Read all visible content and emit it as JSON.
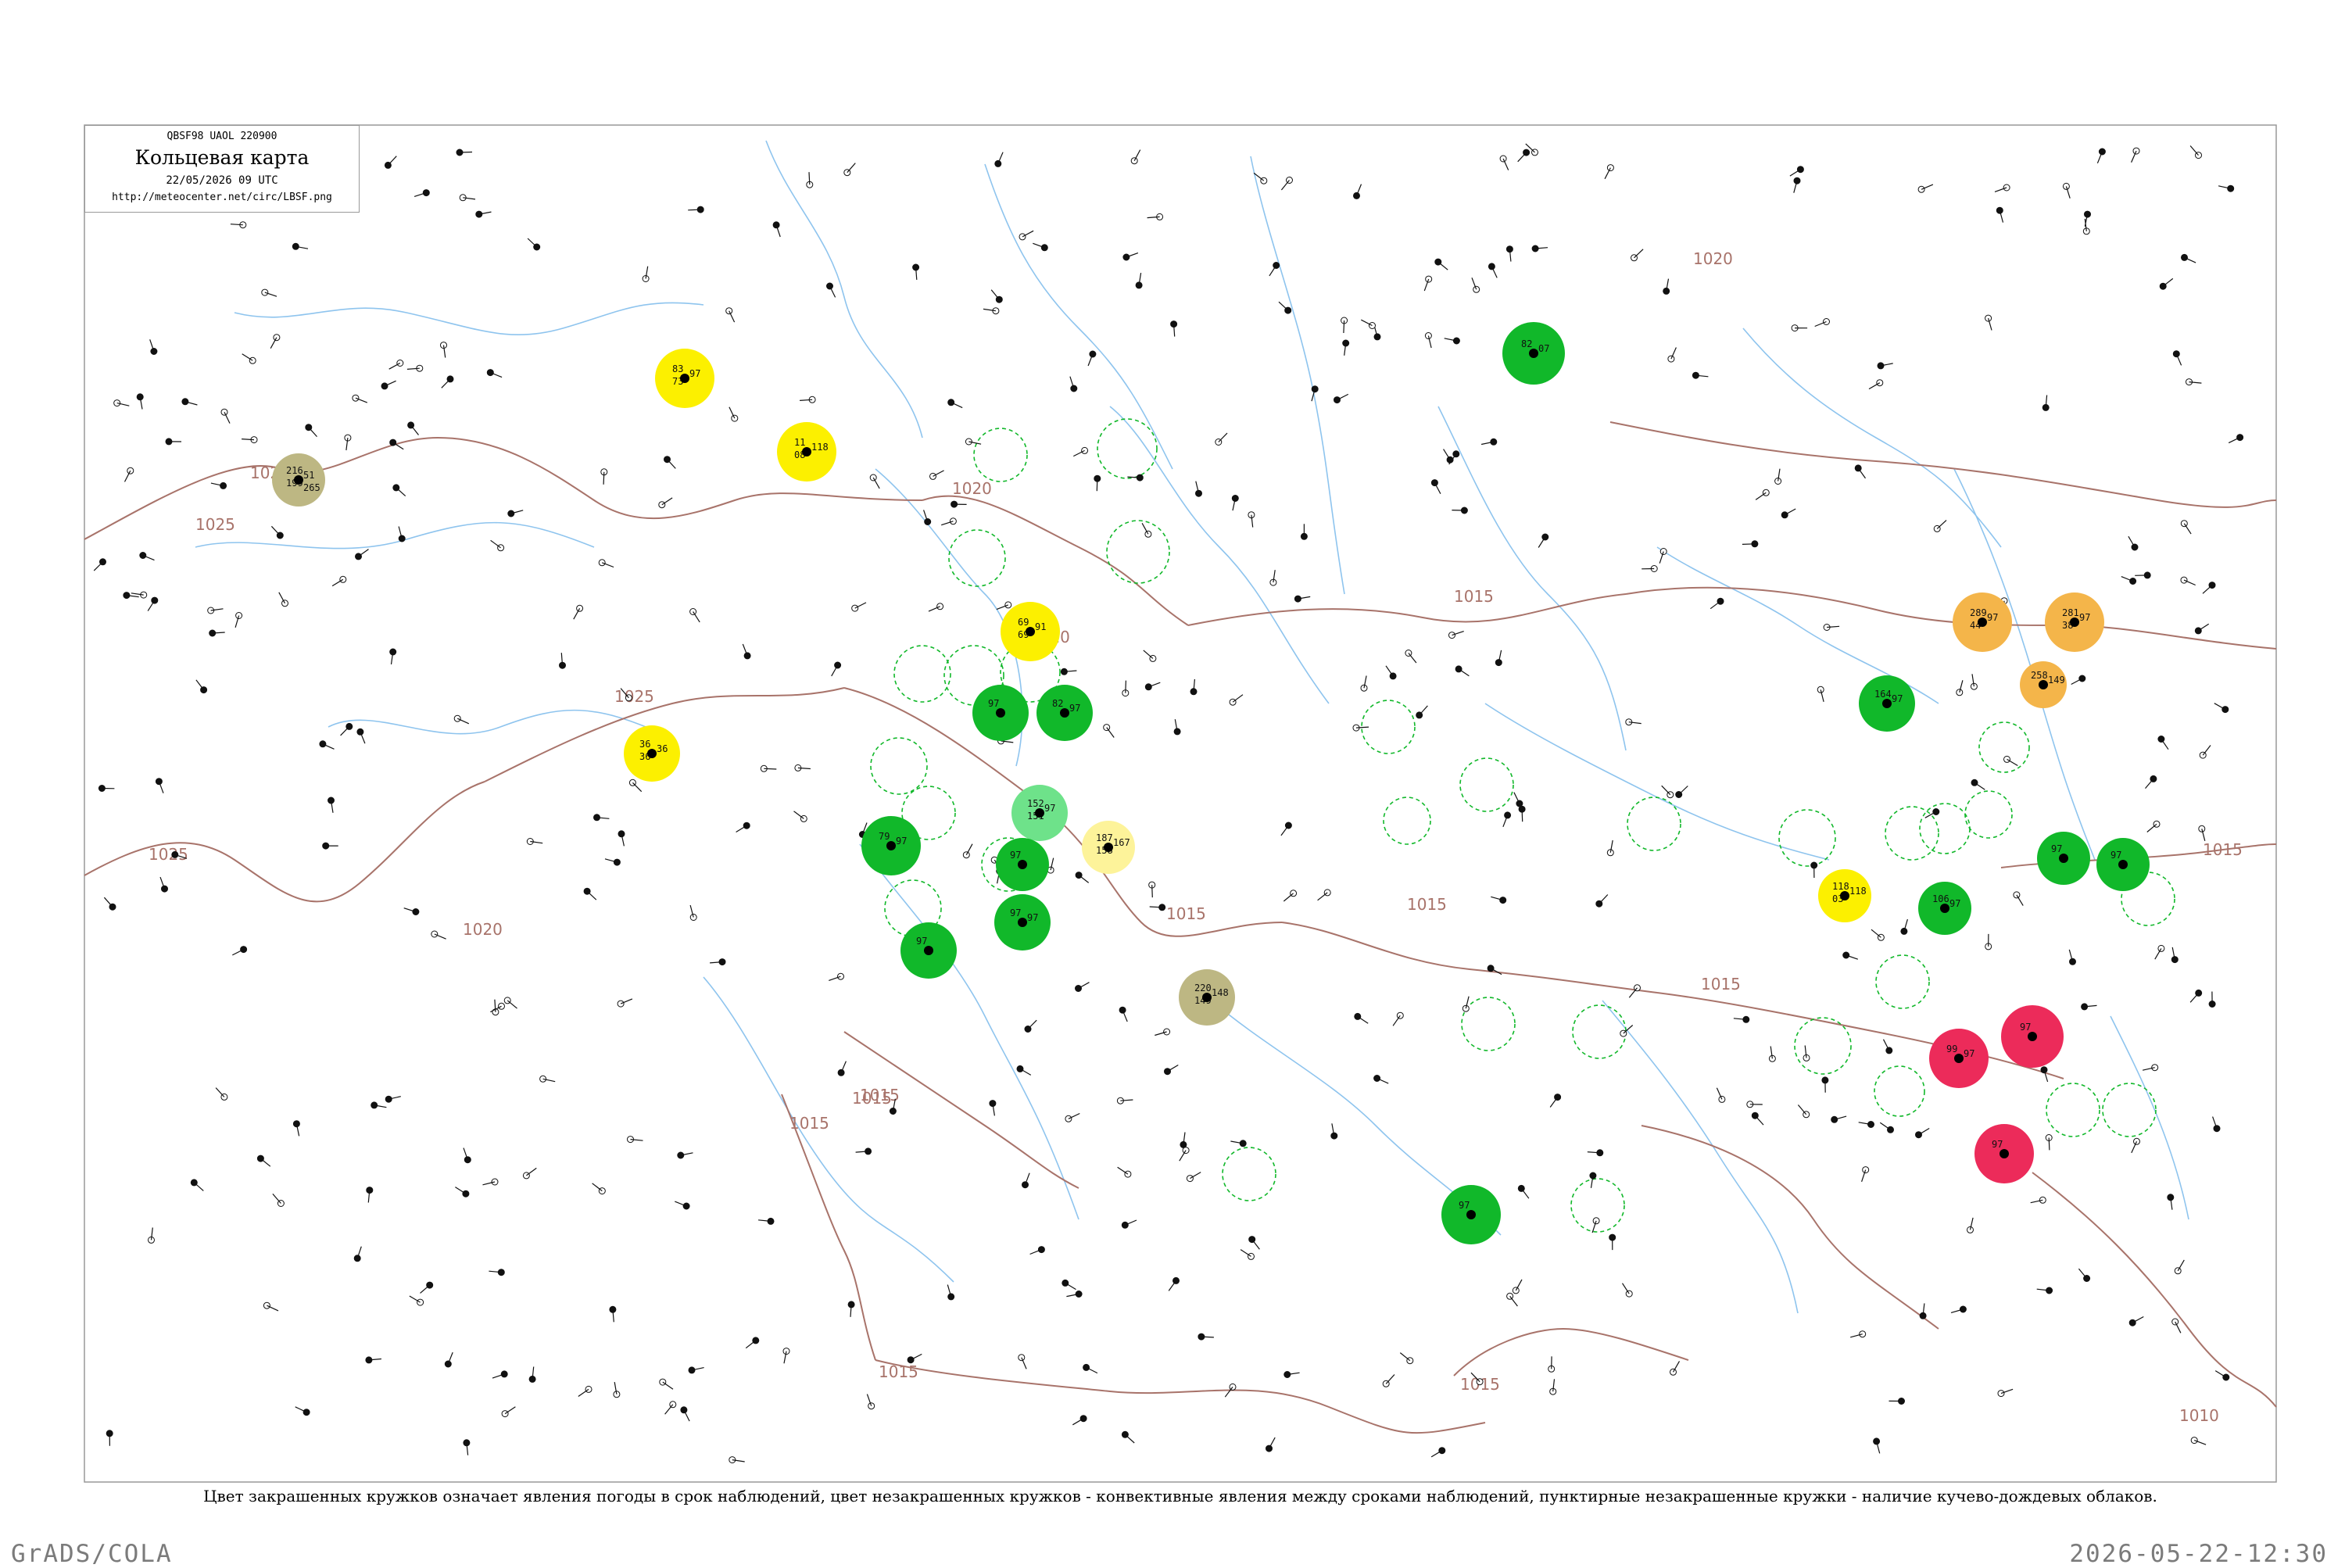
{
  "header": {
    "code": "QBSF98  UAOL  220900",
    "title": "Кольцевая карта",
    "date": "22/05/2026 09 UTC",
    "url": "http://meteocenter.net/circ/LBSF.png"
  },
  "caption": "Цвет закрашенных кружков означает явления погоды в срок наблюдений, цвет незакрашенных кружков - конвективные явления между сроками наблюдений, пунктирные незакрашенные кружки - наличие кучево-дождевых облаков.",
  "footer": {
    "left": "GrADS/COLA",
    "right": "2026-05-22-12:30"
  },
  "colors": {
    "green": "#11b82a",
    "yellow": "#fcf000",
    "orange": "#f4b54a",
    "red": "#ec2b5a",
    "khaki": "#bdb783",
    "light_yellow": "#fdf39a",
    "light_green": "#6ee28a",
    "isobar": "#a8736a",
    "river": "#8ec4ee"
  },
  "isobar_labels": [
    "1025",
    "1025",
    "1025",
    "1025",
    "1020",
    "1020",
    "1020",
    "1020",
    "1015",
    "1015",
    "1015",
    "1015",
    "1015",
    "1015",
    "1015",
    "1015",
    "1015",
    "1015",
    "1010"
  ],
  "highlight_stations": [
    {
      "kind": "filled",
      "color": "green",
      "values": [
        "82",
        "07"
      ]
    },
    {
      "kind": "filled",
      "color": "yellow",
      "values": [
        "83",
        "97",
        "73"
      ]
    },
    {
      "kind": "filled",
      "color": "yellow",
      "values": [
        "11",
        "118",
        "08"
      ]
    },
    {
      "kind": "filled",
      "color": "khaki",
      "values": [
        "216",
        "51",
        "199",
        "265"
      ]
    },
    {
      "kind": "filled",
      "color": "yellow",
      "values": [
        "69",
        "91",
        "69"
      ]
    },
    {
      "kind": "filled",
      "color": "yellow",
      "values": [
        "36",
        "36",
        "36"
      ]
    },
    {
      "kind": "filled",
      "color": "green",
      "values": [
        "97"
      ]
    },
    {
      "kind": "filled",
      "color": "green",
      "values": [
        "82",
        "97"
      ]
    },
    {
      "kind": "filled",
      "color": "green",
      "values": [
        "79",
        "97"
      ]
    },
    {
      "kind": "filled",
      "color": "light_green",
      "values": [
        "152",
        "97",
        "151"
      ]
    },
    {
      "kind": "filled",
      "color": "light_yellow",
      "values": [
        "187",
        "167",
        "158"
      ]
    },
    {
      "kind": "filled",
      "color": "green",
      "values": [
        "97",
        "97"
      ]
    },
    {
      "kind": "filled",
      "color": "green",
      "values": [
        "97"
      ]
    },
    {
      "kind": "filled",
      "color": "khaki",
      "values": [
        "220",
        "148",
        "149"
      ]
    },
    {
      "kind": "filled",
      "color": "green",
      "values": [
        "97"
      ]
    },
    {
      "kind": "filled",
      "color": "green",
      "values": [
        "164",
        "97"
      ]
    },
    {
      "kind": "filled",
      "color": "orange",
      "values": [
        "289",
        "97",
        "44"
      ]
    },
    {
      "kind": "filled",
      "color": "orange",
      "values": [
        "281",
        "97",
        "38"
      ]
    },
    {
      "kind": "filled",
      "color": "orange",
      "values": [
        "258",
        "149"
      ]
    },
    {
      "kind": "filled",
      "color": "yellow",
      "values": [
        "118",
        "118",
        "03"
      ]
    },
    {
      "kind": "filled",
      "color": "green",
      "values": [
        "106",
        "97"
      ]
    },
    {
      "kind": "filled",
      "color": "green",
      "values": [
        "97"
      ]
    },
    {
      "kind": "filled",
      "color": "green",
      "values": [
        "97"
      ]
    },
    {
      "kind": "filled",
      "color": "red",
      "values": [
        "99",
        "97"
      ]
    },
    {
      "kind": "filled",
      "color": "red",
      "values": [
        "97"
      ]
    },
    {
      "kind": "filled",
      "color": "red",
      "values": [
        "97"
      ]
    },
    {
      "kind": "filled",
      "color": "green",
      "values": [
        "97"
      ]
    }
  ]
}
